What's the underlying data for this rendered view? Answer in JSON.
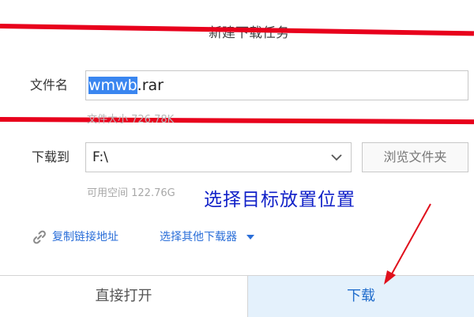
{
  "dialog": {
    "title": "新建下载任务",
    "filename_label": "文件名",
    "filename_selected": "wmwb",
    "filename_ext": ".rar",
    "filesize_text": "文件大小 726.78K",
    "dest_label": "下载到",
    "dest_value": "F:\\",
    "browse_label": "浏览文件夹",
    "free_space": "可用空间 122.76G",
    "copy_link_label": "复制链接地址",
    "other_downloader_label": "选择其他下载器",
    "open_direct_label": "直接打开",
    "download_label": "下载"
  },
  "annotation": {
    "text": "选择目标放置位置"
  },
  "colors": {
    "highlight_red": "#e8001c",
    "annotation_blue": "#1020c8",
    "link_blue": "#2a6ed8",
    "selection_blue": "#3a86f0",
    "download_bg": "#e4f1fc"
  }
}
